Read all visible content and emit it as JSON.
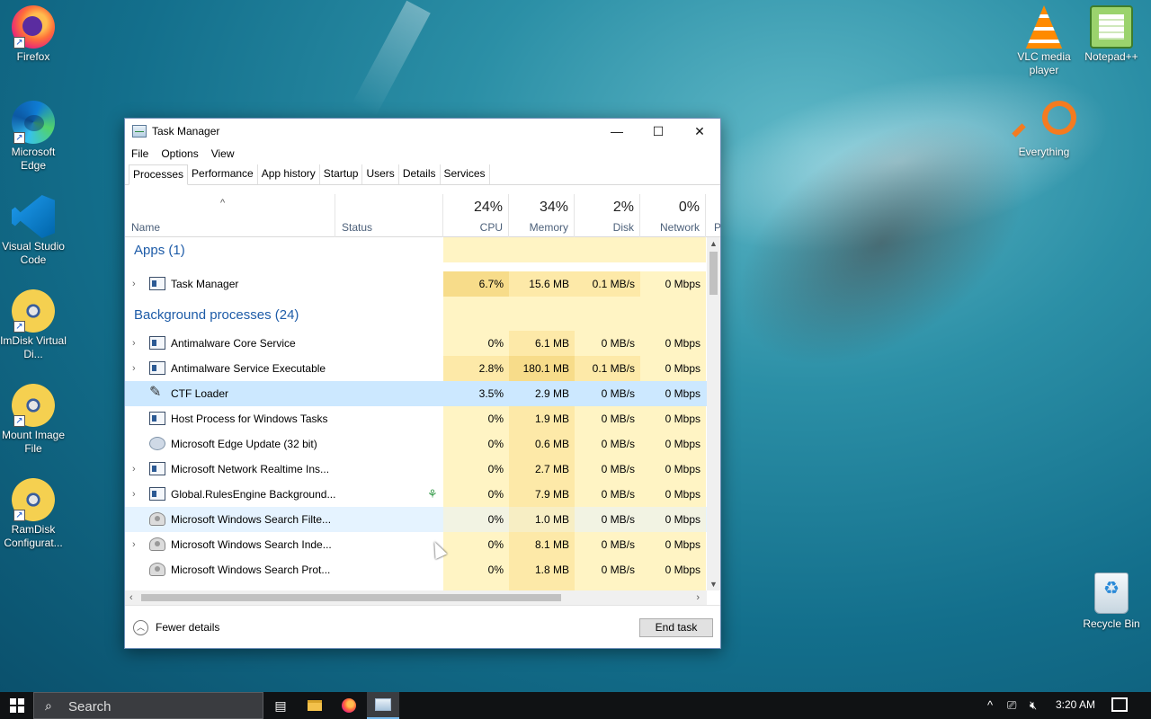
{
  "desktop": {
    "left_icons": [
      {
        "label": "Firefox",
        "icon": "firefox-icon"
      },
      {
        "label": "Microsoft Edge",
        "icon": "edge-icon"
      },
      {
        "label": "Visual Studio Code",
        "icon": "vscode-icon"
      },
      {
        "label": "ImDisk Virtual Di...",
        "icon": "disc-icon"
      },
      {
        "label": "Mount Image File",
        "icon": "disc-icon"
      },
      {
        "label": "RamDisk Configurat...",
        "icon": "disc-icon"
      }
    ],
    "right_icons": [
      {
        "label": "VLC media player",
        "icon": "vlc-icon"
      },
      {
        "label": "Notepad++",
        "icon": "notepad-icon"
      },
      {
        "label": "Everything",
        "icon": "everything-icon"
      },
      {
        "label": "Recycle Bin",
        "icon": "recycle-bin-icon"
      }
    ]
  },
  "window": {
    "title": "Task Manager",
    "menu": [
      "File",
      "Options",
      "View"
    ],
    "tabs": [
      "Processes",
      "Performance",
      "App history",
      "Startup",
      "Users",
      "Details",
      "Services"
    ],
    "active_tab": "Processes",
    "columns": {
      "name": "Name",
      "status": "Status",
      "cpu": {
        "pct": "24%",
        "label": "CPU"
      },
      "memory": {
        "pct": "34%",
        "label": "Memory"
      },
      "disk": {
        "pct": "2%",
        "label": "Disk"
      },
      "network": {
        "pct": "0%",
        "label": "Network"
      },
      "power_stub": "P"
    },
    "groups": {
      "apps": "Apps (1)",
      "background": "Background processes (24)"
    },
    "apps": [
      {
        "name": "Task Manager",
        "cpu": "6.7%",
        "memory": "15.6 MB",
        "disk": "0.1 MB/s",
        "network": "0 Mbps"
      }
    ],
    "background": [
      {
        "name": "Antimalware Core Service",
        "cpu": "0%",
        "memory": "6.1 MB",
        "disk": "0 MB/s",
        "network": "0 Mbps"
      },
      {
        "name": "Antimalware Service Executable",
        "cpu": "2.8%",
        "memory": "180.1 MB",
        "disk": "0.1 MB/s",
        "network": "0 Mbps"
      },
      {
        "name": "CTF Loader",
        "cpu": "3.5%",
        "memory": "2.9 MB",
        "disk": "0 MB/s",
        "network": "0 Mbps"
      },
      {
        "name": "Host Process for Windows Tasks",
        "cpu": "0%",
        "memory": "1.9 MB",
        "disk": "0 MB/s",
        "network": "0 Mbps"
      },
      {
        "name": "Microsoft Edge Update (32 bit)",
        "cpu": "0%",
        "memory": "0.6 MB",
        "disk": "0 MB/s",
        "network": "0 Mbps"
      },
      {
        "name": "Microsoft Network Realtime Ins...",
        "cpu": "0%",
        "memory": "2.7 MB",
        "disk": "0 MB/s",
        "network": "0 Mbps"
      },
      {
        "name": "Global.RulesEngine Background...",
        "cpu": "0%",
        "memory": "7.9 MB",
        "disk": "0 MB/s",
        "network": "0 Mbps"
      },
      {
        "name": "Microsoft Windows Search Filte...",
        "cpu": "0%",
        "memory": "1.0 MB",
        "disk": "0 MB/s",
        "network": "0 Mbps"
      },
      {
        "name": "Microsoft Windows Search Inde...",
        "cpu": "0%",
        "memory": "8.1 MB",
        "disk": "0 MB/s",
        "network": "0 Mbps"
      },
      {
        "name": "Microsoft Windows Search Prot...",
        "cpu": "0%",
        "memory": "1.8 MB",
        "disk": "0 MB/s",
        "network": "0 Mbps"
      }
    ],
    "footer": {
      "fewer_details": "Fewer details",
      "end_task": "End task"
    }
  },
  "taskbar": {
    "search_placeholder": "Search",
    "clock": "3:20 AM"
  }
}
